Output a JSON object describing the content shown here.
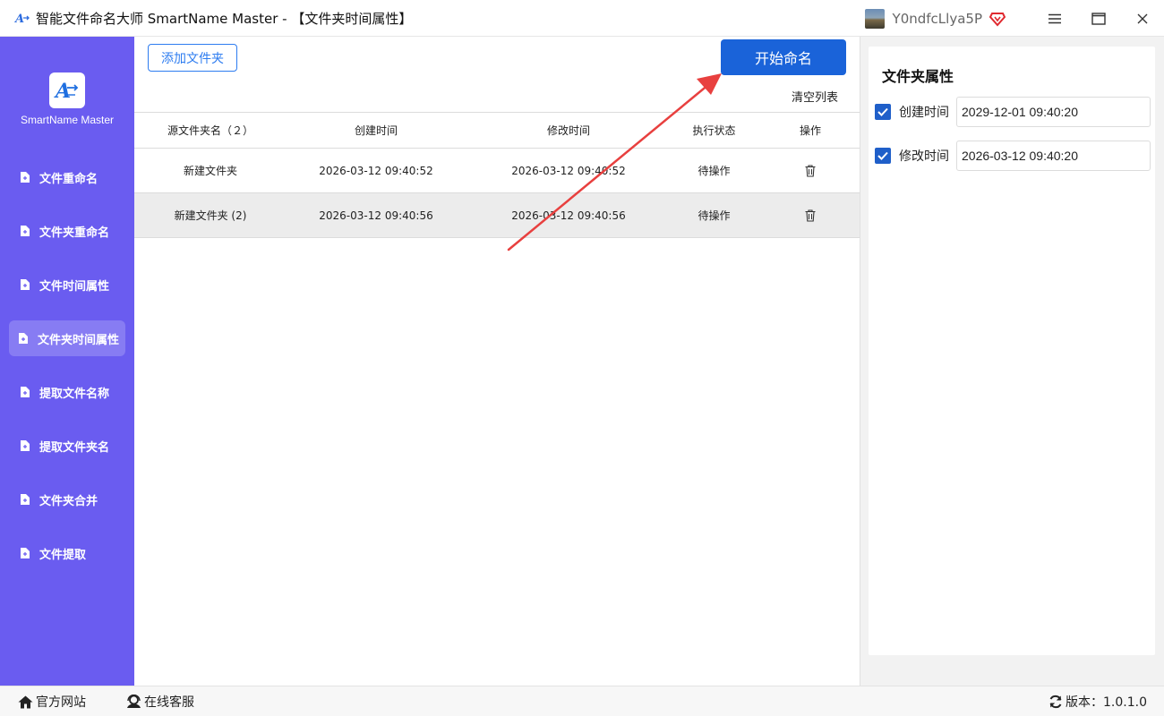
{
  "window": {
    "title": "智能文件命名大师 SmartName Master - 【文件夹时间属性】",
    "username": "Y0ndfcLlya5P",
    "icons": [
      "app-logo-icon",
      "avatar",
      "vip-diamond-icon",
      "menu-icon",
      "maximize-icon",
      "close-icon"
    ]
  },
  "sidebar": {
    "brand": "SmartName Master",
    "items": [
      {
        "label": "文件重命名",
        "active": false
      },
      {
        "label": "文件夹重命名",
        "active": false
      },
      {
        "label": "文件时间属性",
        "active": false
      },
      {
        "label": "文件夹时间属性",
        "active": true
      },
      {
        "label": "提取文件名称",
        "active": false
      },
      {
        "label": "提取文件夹名",
        "active": false
      },
      {
        "label": "文件夹合并",
        "active": false
      },
      {
        "label": "文件提取",
        "active": false
      }
    ]
  },
  "toolbar": {
    "add_folder": "添加文件夹",
    "start": "开始命名",
    "clear": "清空列表"
  },
  "table": {
    "headers": [
      "源文件夹名（２）",
      "创建时间",
      "修改时间",
      "执行状态",
      "操作"
    ],
    "rows": [
      {
        "name": "新建文件夹",
        "created": "2026-03-12 09:40:52",
        "modified": "2026-03-12 09:40:52",
        "status": "待操作"
      },
      {
        "name": "新建文件夹 (2)",
        "created": "2026-03-12 09:40:56",
        "modified": "2026-03-12 09:40:56",
        "status": "待操作"
      }
    ]
  },
  "panel": {
    "title": "文件夹属性",
    "created_label": "创建时间",
    "created_checked": true,
    "created_value": "2029-12-01 09:40:20",
    "modified_label": "修改时间",
    "modified_checked": true,
    "modified_value": "2026-03-12 09:40:20"
  },
  "statusbar": {
    "website": "官方网站",
    "support": "在线客服",
    "version": "版本：1.0.1.0"
  },
  "colors": {
    "sidebar": "#6a5cf0",
    "primary": "#1a63d9",
    "arrow": "#e8403f"
  }
}
